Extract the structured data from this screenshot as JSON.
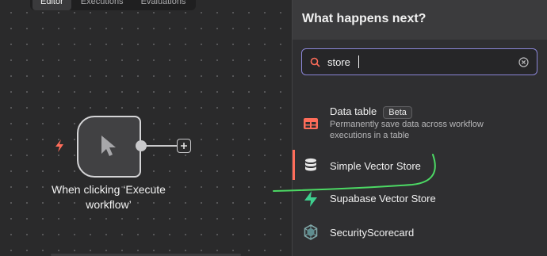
{
  "canvas": {
    "tabs": [
      {
        "label": "Editor",
        "active": true
      },
      {
        "label": "Executions",
        "active": false
      },
      {
        "label": "Evaluations",
        "active": false
      }
    ],
    "trigger_node": {
      "label": "When clicking ‘Execute workflow’",
      "icon": "mouse-pointer-icon",
      "trigger_icon": "lightning-bolt-icon"
    }
  },
  "panel": {
    "title": "What happens next?",
    "search": {
      "value": "store",
      "placeholder": ""
    },
    "items": [
      {
        "title": "Data table",
        "badge": "Beta",
        "description": "Permanently save data across workflow executions in a table",
        "icon": "table-icon"
      },
      {
        "title": "Simple Vector Store",
        "icon": "database-icon",
        "selected": true
      },
      {
        "title": "Supabase Vector Store",
        "icon": "supabase-bolt-icon"
      },
      {
        "title": "SecurityScorecard",
        "icon": "securityscorecard-icon"
      }
    ]
  },
  "colors": {
    "accent": "#ff6d5a",
    "search_border": "#8a85d6",
    "supabase_green": "#3ecf8e",
    "annotation_green": "#4cd964"
  }
}
